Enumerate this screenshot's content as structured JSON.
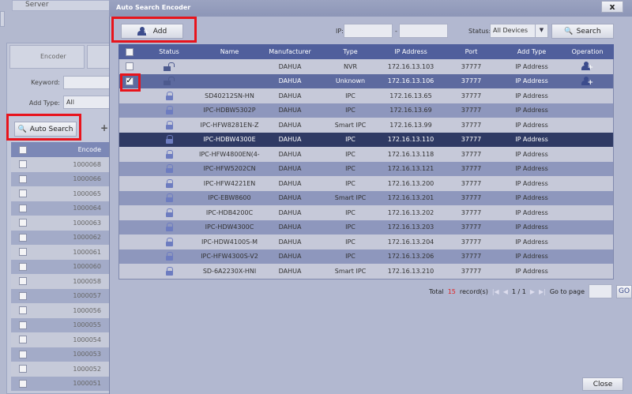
{
  "background": {
    "server_tab": "Server",
    "encoder_tab": "Encoder",
    "keyword_label": "Keyword:",
    "add_type_label": "Add Type:",
    "add_type_value": "All",
    "auto_search_label": "Auto Search",
    "list_header": "Encode",
    "encodes": [
      "1000068",
      "1000066",
      "1000065",
      "1000064",
      "1000063",
      "1000062",
      "1000061",
      "1000060",
      "1000058",
      "1000057",
      "1000056",
      "1000055",
      "1000054",
      "1000053",
      "1000052",
      "1000051"
    ]
  },
  "dialog": {
    "title": "Auto Search Encoder",
    "close_icon": "x",
    "add_label": "Add",
    "ip_label": "IP:",
    "ip_dash": "-",
    "status_label": "Status:",
    "status_value": "All Devices",
    "search_label": "Search",
    "columns": [
      "Status",
      "Name",
      "Manufacturer",
      "Type",
      "IP Address",
      "Port",
      "Add Type",
      "Operation"
    ],
    "rows": [
      {
        "status": "unlocked",
        "name": "",
        "mfr": "DAHUA",
        "type": "NVR",
        "ip": "172.16.13.103",
        "port": "37777",
        "add_type": "IP Address",
        "op": true,
        "checkbox": true,
        "checked": false
      },
      {
        "status": "unlocked",
        "name": "",
        "mfr": "DAHUA",
        "type": "Unknown",
        "ip": "172.16.13.106",
        "port": "37777",
        "add_type": "IP Address",
        "op": true,
        "checkbox": true,
        "checked": true
      },
      {
        "status": "locked",
        "name": "SD40212SN-HN",
        "mfr": "DAHUA",
        "type": "IPC",
        "ip": "172.16.13.65",
        "port": "37777",
        "add_type": "IP Address"
      },
      {
        "status": "locked",
        "name": "IPC-HDBW5302P",
        "mfr": "DAHUA",
        "type": "IPC",
        "ip": "172.16.13.69",
        "port": "37777",
        "add_type": "IP Address"
      },
      {
        "status": "locked",
        "name": "IPC-HFW8281EN-Z",
        "mfr": "DAHUA",
        "type": "Smart IPC",
        "ip": "172.16.13.99",
        "port": "37777",
        "add_type": "IP Address"
      },
      {
        "status": "locked",
        "name": "IPC-HDBW4300E",
        "mfr": "DAHUA",
        "type": "IPC",
        "ip": "172.16.13.110",
        "port": "37777",
        "add_type": "IP Address"
      },
      {
        "status": "locked",
        "name": "IPC-HFW4800EN(4-...",
        "mfr": "DAHUA",
        "type": "IPC",
        "ip": "172.16.13.118",
        "port": "37777",
        "add_type": "IP Address"
      },
      {
        "status": "locked",
        "name": "IPC-HFW5202CN",
        "mfr": "DAHUA",
        "type": "IPC",
        "ip": "172.16.13.121",
        "port": "37777",
        "add_type": "IP Address"
      },
      {
        "status": "locked",
        "name": "IPC-HFW4221EN",
        "mfr": "DAHUA",
        "type": "IPC",
        "ip": "172.16.13.200",
        "port": "37777",
        "add_type": "IP Address"
      },
      {
        "status": "locked",
        "name": "IPC-EBW8600",
        "mfr": "DAHUA",
        "type": "Smart IPC",
        "ip": "172.16.13.201",
        "port": "37777",
        "add_type": "IP Address"
      },
      {
        "status": "locked",
        "name": "IPC-HDB4200C",
        "mfr": "DAHUA",
        "type": "IPC",
        "ip": "172.16.13.202",
        "port": "37777",
        "add_type": "IP Address"
      },
      {
        "status": "locked",
        "name": "IPC-HDW4300C",
        "mfr": "DAHUA",
        "type": "IPC",
        "ip": "172.16.13.203",
        "port": "37777",
        "add_type": "IP Address"
      },
      {
        "status": "locked",
        "name": "IPC-HDW4100S-M",
        "mfr": "DAHUA",
        "type": "IPC",
        "ip": "172.16.13.204",
        "port": "37777",
        "add_type": "IP Address"
      },
      {
        "status": "locked",
        "name": "IPC-HFW4300S-V2",
        "mfr": "DAHUA",
        "type": "IPC",
        "ip": "172.16.13.206",
        "port": "37777",
        "add_type": "IP Address"
      },
      {
        "status": "locked",
        "name": "SD-6A2230X-HNI",
        "mfr": "DAHUA",
        "type": "Smart IPC",
        "ip": "172.16.13.210",
        "port": "37777",
        "add_type": "IP Address"
      }
    ],
    "footer": {
      "total_label": "Total",
      "total": "15",
      "records_label": "record(s)",
      "page": "1 / 1",
      "goto_label": "Go to page",
      "go_label": "GO"
    },
    "close_label": "Close"
  },
  "colors": {
    "highlight": "#e8141c",
    "header": "#505f9c",
    "selected": "#2f3a64",
    "total": "#e02020"
  }
}
